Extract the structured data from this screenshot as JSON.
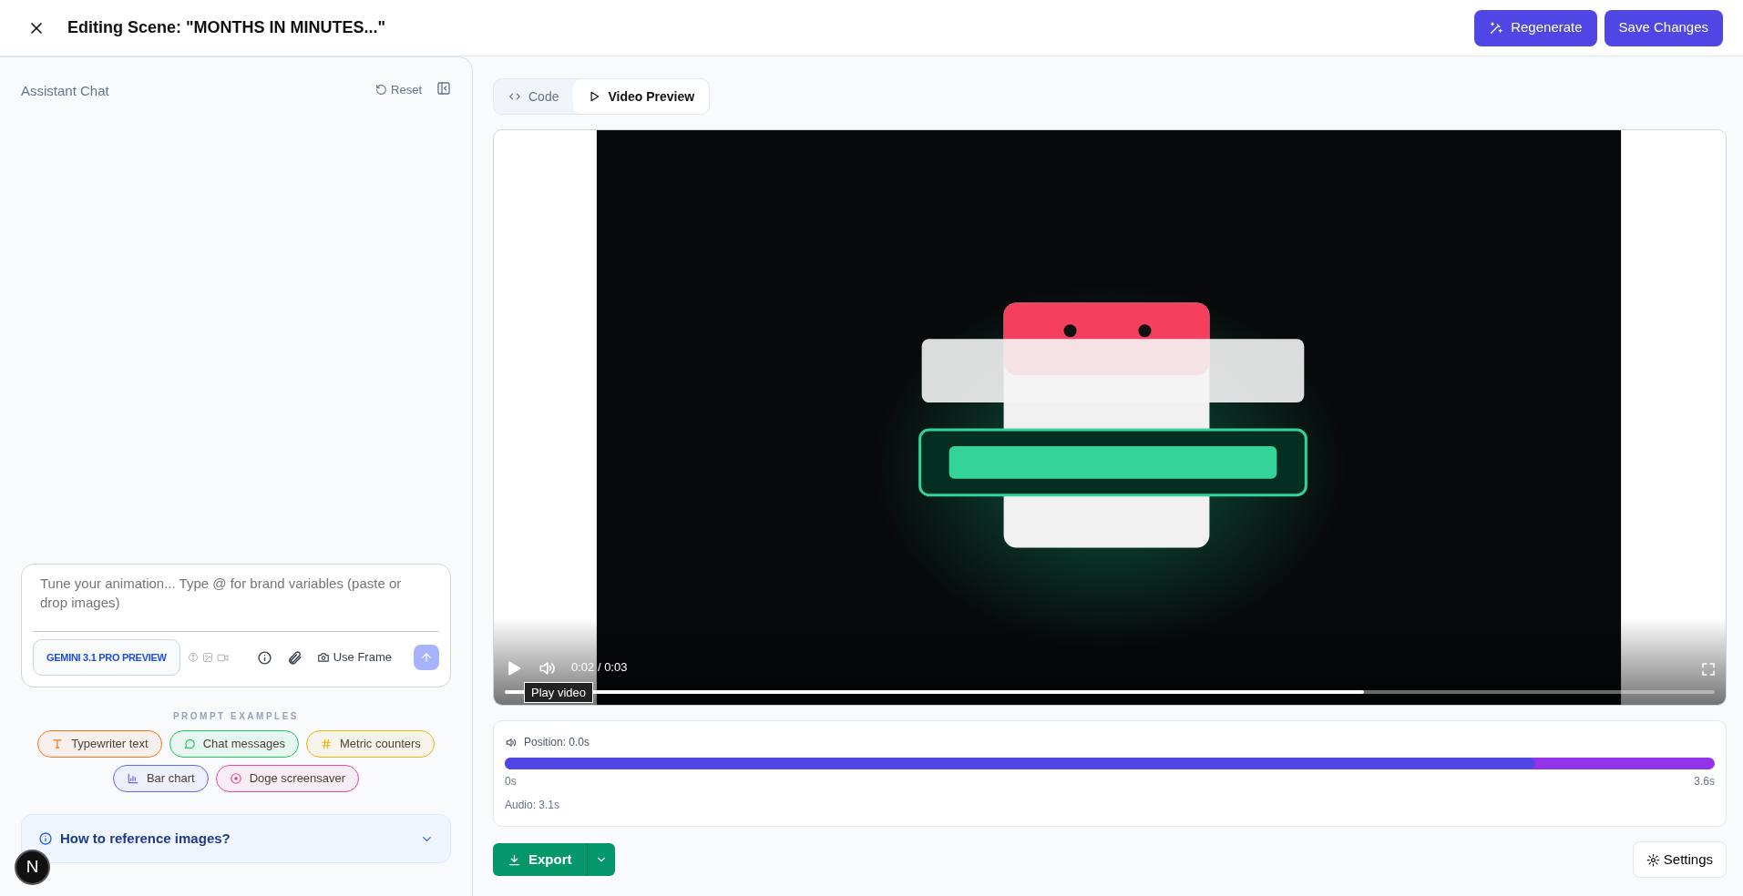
{
  "header": {
    "title": "Editing Scene: \"MONTHS IN MINUTES...\"",
    "buttons": [
      {
        "label": "Regenerate",
        "kind": "wand"
      },
      {
        "label": "Save Changes",
        "kind": "plain"
      }
    ]
  },
  "chat": {
    "title": "Assistant Chat",
    "reset": "Reset",
    "input": {
      "placeholder": "Tune your animation... Type @ for brand variables (paste or drop images)"
    },
    "model": "GEMINI 3.1 PRO PREVIEW",
    "use_frame": "Use Frame",
    "send": {
      "disabled": true
    },
    "prompt_heading": "PROMPT EXAMPLES",
    "prompt_examples": [
      {
        "label": "Typewriter text",
        "kind": "type",
        "color": "#f97316"
      },
      {
        "label": "Chat messages",
        "kind": "chat",
        "color": "#22c55e"
      },
      {
        "label": "Metric counters",
        "kind": "hash",
        "color": "#eab308"
      },
      {
        "label": "Bar chart",
        "kind": "bars",
        "color": "#6366f1"
      },
      {
        "label": "Doge screensaver",
        "kind": "target",
        "color": "#ec4899"
      }
    ],
    "help": {
      "label": "How to reference images?",
      "expanded": false
    }
  },
  "tabs": [
    {
      "label": "Code",
      "kind": "code",
      "selected": false
    },
    {
      "label": "Video Preview",
      "kind": "play",
      "selected": true
    }
  ],
  "player": {
    "time": "0:02 / 0:03",
    "tooltip": "Play video",
    "level": 0.71
  },
  "audio": {
    "position": "Position: 0.0s",
    "level": 0.852,
    "start": "0s",
    "end": "3.6s",
    "duration": "Audio: 3.1s"
  },
  "export": "Export",
  "settings": "Settings",
  "avatar": "N"
}
